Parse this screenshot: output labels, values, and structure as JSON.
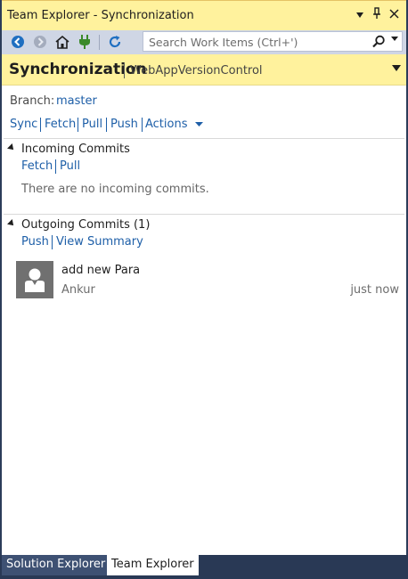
{
  "window": {
    "title": "Team Explorer - Synchronization",
    "dropdown_glyph": "▼",
    "pin_glyph": "📌",
    "close_glyph": "✕"
  },
  "toolbar": {
    "search_placeholder": "Search Work Items (Ctrl+')",
    "icons": [
      "back-icon",
      "forward-icon",
      "home-icon",
      "connect-icon",
      "refresh-icon",
      "search-icon"
    ]
  },
  "page": {
    "title": "Synchronization",
    "subtitle": "WebAppVersionControl"
  },
  "branch": {
    "label": "Branch:",
    "value": "master"
  },
  "actions": {
    "sync": "Sync",
    "fetch": "Fetch",
    "pull": "Pull",
    "push": "Push",
    "more": "Actions"
  },
  "incoming": {
    "title": "Incoming Commits",
    "fetch": "Fetch",
    "pull": "Pull",
    "empty_message": "There are no incoming commits."
  },
  "outgoing": {
    "title": "Outgoing Commits (1)",
    "push": "Push",
    "view_summary": "View Summary",
    "commits": [
      {
        "message": "add new Para",
        "author": "Ankur",
        "time": "just now"
      }
    ]
  },
  "tabs": [
    {
      "label": "Solution Explorer",
      "active": false
    },
    {
      "label": "Team Explorer",
      "active": true
    }
  ],
  "colors": {
    "title_bar": "#fff29d",
    "toolbar": "#cfd6e5",
    "link": "#1e5fa8",
    "frame": "#293955"
  }
}
